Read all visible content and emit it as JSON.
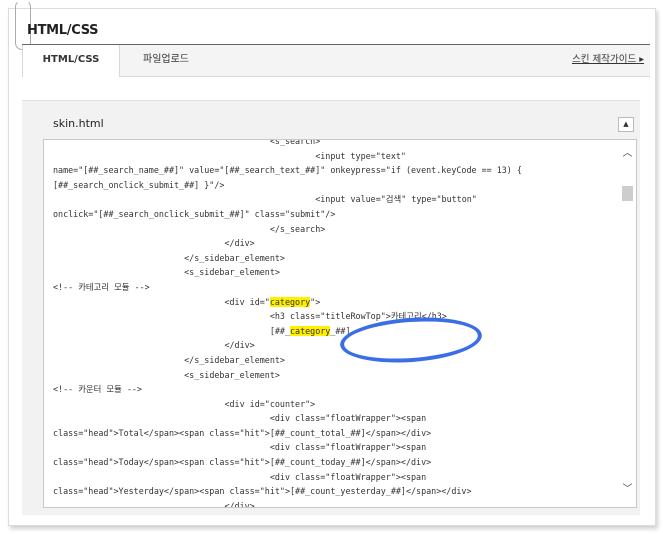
{
  "page_title": "HTML/CSS",
  "tabs": [
    {
      "label": "HTML/CSS",
      "active": true
    },
    {
      "label": "파일업로드",
      "active": false
    }
  ],
  "guide_link": "스킨 제작가이드",
  "file_name": "skin.html",
  "colors": {
    "highlight": "#fff000",
    "annotation": "#3b6ee6"
  },
  "code_lines": [
    {
      "indent": 43,
      "text": "<s_search>"
    },
    {
      "indent": 52,
      "text": "<input type=\"text\""
    },
    {
      "indent": 0,
      "text": "name=\"[##_search_name_##]\" value=\"[##_search_text_##]\" onkeypress=\"if (event.keyCode == 13) {"
    },
    {
      "indent": 0,
      "text": "[##_search_onclick_submit_##] }\"/>"
    },
    {
      "indent": 52,
      "text": "<input value=\"검색\" type=\"button\""
    },
    {
      "indent": 0,
      "text": "onclick=\"[##_search_onclick_submit_##]\" class=\"submit\"/>"
    },
    {
      "indent": 43,
      "text": "</s_search>"
    },
    {
      "indent": 34,
      "text": "</div>"
    },
    {
      "indent": 26,
      "text": "</s_sidebar_element>"
    },
    {
      "indent": 26,
      "text": "<s_sidebar_element>"
    },
    {
      "indent": 0,
      "text": "<!-- 카테고리 모듈 -->"
    },
    {
      "indent": 34,
      "parts": [
        {
          "t": "<div id=\""
        },
        {
          "t": "category",
          "hl": true
        },
        {
          "t": "\">"
        }
      ]
    },
    {
      "indent": 43,
      "text": "<h3 class=\"titleRowTop\">카테고리</h3>"
    },
    {
      "indent": 43,
      "parts": [
        {
          "t": "[##_"
        },
        {
          "t": "category",
          "hl": true
        },
        {
          "t": "_##]"
        }
      ]
    },
    {
      "indent": 34,
      "text": "</div>"
    },
    {
      "indent": 26,
      "text": "</s_sidebar_element>"
    },
    {
      "indent": 26,
      "text": "<s_sidebar_element>"
    },
    {
      "indent": 0,
      "text": "<!-- 카운터 모듈 -->"
    },
    {
      "indent": 34,
      "text": "<div id=\"counter\">"
    },
    {
      "indent": 43,
      "text": "<div class=\"floatWrapper\"><span"
    },
    {
      "indent": 0,
      "text": "class=\"head\">Total</span><span class=\"hit\">[##_count_total_##]</span></div>"
    },
    {
      "indent": 43,
      "text": "<div class=\"floatWrapper\"><span"
    },
    {
      "indent": 0,
      "text": "class=\"head\">Today</span><span class=\"hit\">[##_count_today_##]</span></div>"
    },
    {
      "indent": 43,
      "text": "<div class=\"floatWrapper\"><span"
    },
    {
      "indent": 0,
      "text": "class=\"head\">Yesterday</span><span class=\"hit\">[##_count_yesterday_##]</span></div>"
    },
    {
      "indent": 34,
      "text": "</div>"
    }
  ]
}
